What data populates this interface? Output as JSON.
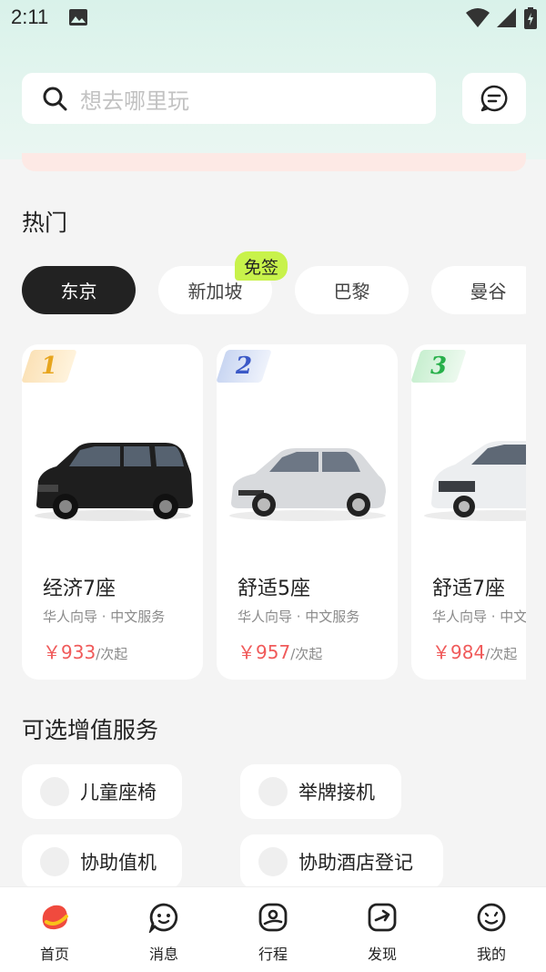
{
  "status_bar": {
    "time": "2:11"
  },
  "search": {
    "placeholder": "想去哪里玩"
  },
  "hot": {
    "title": "热门",
    "cities": [
      "东京",
      "新加坡",
      "巴黎",
      "曼谷"
    ],
    "active_city": "东京",
    "visa_badge": "免签"
  },
  "cars": [
    {
      "rank": "1",
      "name": "经济7座",
      "desc": "华人向导 · 中文服务",
      "price": "￥933",
      "unit": "/次起",
      "rank_color": "#e7a51d"
    },
    {
      "rank": "2",
      "name": "舒适5座",
      "desc": "华人向导 · 中文服务",
      "price": "￥957",
      "unit": "/次起",
      "rank_color": "#3b59c7"
    },
    {
      "rank": "3",
      "name": "舒适7座",
      "desc": "华人向导 · 中文服务",
      "price": "￥984",
      "unit": "/次起",
      "rank_color": "#27b04a"
    }
  ],
  "services": {
    "title": "可选增值服务",
    "items": [
      "儿童座椅",
      "举牌接机",
      "协助值机",
      "协助酒店登记"
    ]
  },
  "nav": {
    "items": [
      {
        "label": "首页",
        "icon": "home-icon"
      },
      {
        "label": "消息",
        "icon": "chat-icon"
      },
      {
        "label": "行程",
        "icon": "trip-icon"
      },
      {
        "label": "发现",
        "icon": "discover-icon"
      },
      {
        "label": "我的",
        "icon": "profile-icon"
      }
    ]
  },
  "colors": {
    "accent": "#f05a5a",
    "badge": "#c8f24b",
    "active_pill": "#222222"
  }
}
